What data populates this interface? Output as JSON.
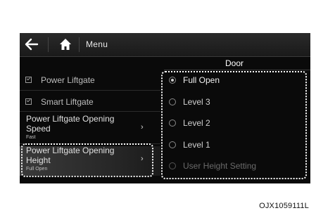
{
  "nav": {
    "back_icon": "arrow-left-icon",
    "home_icon": "home-icon",
    "menu_label": "Menu"
  },
  "panel": {
    "title": "Door"
  },
  "settings": {
    "power_liftgate": {
      "label": "Power Liftgate",
      "checked": true
    },
    "smart_liftgate": {
      "label": "Smart Liftgate",
      "checked": true
    },
    "opening_speed": {
      "title_line1": "Power Liftgate Opening",
      "title_line2": "Speed",
      "value": "Fast"
    },
    "opening_height": {
      "title_line1": "Power Liftgate Opening",
      "title_line2": "Height",
      "value": "Full Open"
    }
  },
  "height_options": [
    {
      "label": "Full Open",
      "selected": true,
      "enabled": true
    },
    {
      "label": "Level 3",
      "selected": false,
      "enabled": true
    },
    {
      "label": "Level 2",
      "selected": false,
      "enabled": true
    },
    {
      "label": "Level 1",
      "selected": false,
      "enabled": true
    },
    {
      "label": "User Height Setting",
      "selected": false,
      "enabled": false
    }
  ],
  "caption": "OJX1059111L"
}
